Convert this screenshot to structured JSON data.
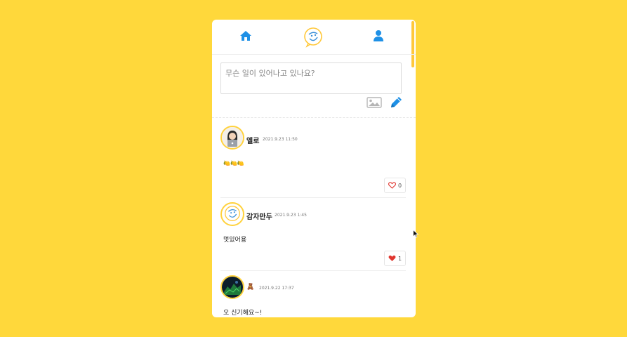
{
  "nav": {
    "home_icon": "home-icon",
    "logo_icon": "logo-icon",
    "user_icon": "user-icon"
  },
  "composer": {
    "placeholder": "무슨 일이 있어나고 있나요?",
    "image_icon": "image-icon",
    "write_icon": "pencil-icon"
  },
  "posts": [
    {
      "author": "옐로",
      "time": "2021.9.23 11:50",
      "body": "🍋🍋🍋",
      "likes": "0",
      "liked": false
    },
    {
      "author": "감자만두",
      "time": "2021.9.23 1:45",
      "body": "멋있어용",
      "likes": "1",
      "liked": true
    },
    {
      "author": "🧸",
      "time": "2021.9.22 17:37",
      "body": "오 신기해요~!",
      "likes": "",
      "liked": false
    }
  ],
  "colors": {
    "background": "#FFD83B",
    "accent_blue": "#1E90E6",
    "like_red": "#E0362F",
    "avatar_border": "#FFD23C"
  }
}
